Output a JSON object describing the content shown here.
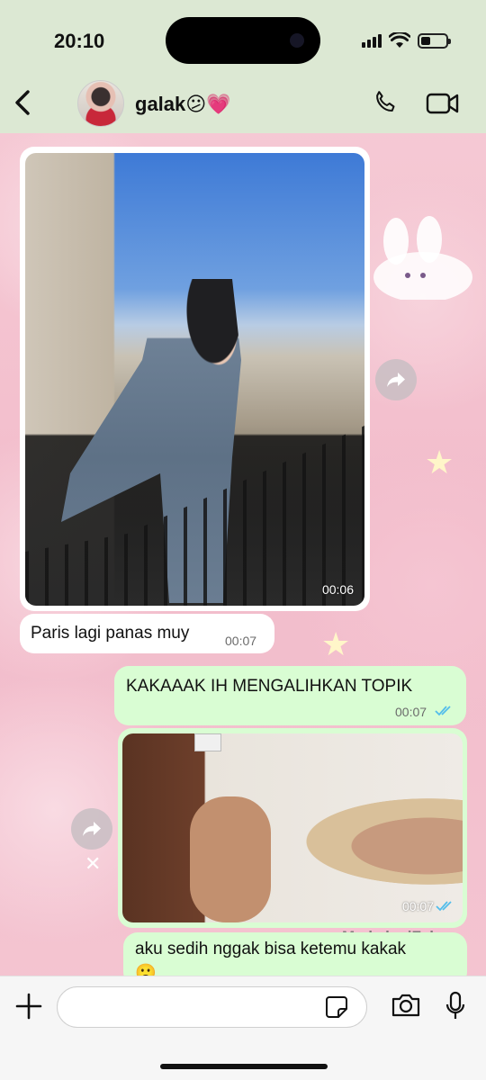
{
  "status_bar": {
    "time": "20:10"
  },
  "header": {
    "contact_name": "galak😕💗",
    "icons": {
      "back": "chevron-left-icon",
      "call": "phone-icon",
      "video": "video-camera-icon"
    }
  },
  "messages": [
    {
      "type": "video",
      "direction": "incoming",
      "duration": "00:06"
    },
    {
      "type": "text",
      "direction": "incoming",
      "text": "Paris lagi panas muy",
      "time": "00:07"
    },
    {
      "type": "text",
      "direction": "outgoing",
      "text": "KAKAAAK IH MENGALIHKAN TOPIK",
      "time": "00:07",
      "status": "read"
    },
    {
      "type": "video",
      "direction": "outgoing",
      "duration": "00:07",
      "status": "read"
    },
    {
      "type": "text",
      "direction": "outgoing",
      "text": "aku sedih nggak bisa ketemu kakak",
      "emoji": "🙁"
    }
  ],
  "watermark": "Made by iFake",
  "composer": {
    "value": "",
    "icons": {
      "attach": "plus-icon",
      "sticker": "sticker-icon",
      "camera": "camera-icon",
      "mic": "microphone-icon"
    }
  },
  "colors": {
    "header_bg": "#dce8d3",
    "outgoing_bubble": "#d9fdd3",
    "incoming_bubble": "#ffffff",
    "read_tick": "#53bdeb"
  }
}
